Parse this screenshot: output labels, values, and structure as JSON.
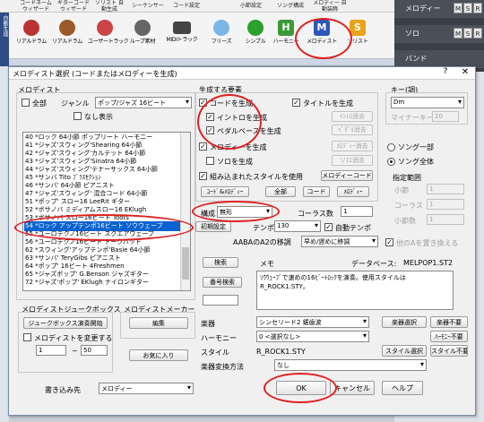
{
  "app": {
    "top_menu": [
      "コードネーム\nウィザード",
      "ギターコード\nウィザード",
      "ソリスト\n自動生成",
      "シーケンサー",
      "コード設定",
      "小節設定",
      "ソング構成",
      "メロディー\n自動装飾"
    ],
    "toolbar": [
      "リアルドラム",
      "リアルドラム",
      "ユーザートラック",
      "ループ素材",
      "MIDIトラック",
      "フリーズ",
      "シンプル",
      "ハーモニー",
      "メロディスト",
      "ソリスト"
    ],
    "left_strip": [
      "自動生成"
    ],
    "tracks": [
      {
        "name": "メロディー"
      },
      {
        "name": "ソロ"
      },
      {
        "name": "バンド"
      }
    ],
    "msr": [
      "M",
      "S",
      "R"
    ]
  },
  "dialog": {
    "title": "メロディスト選択 (コードまたはメロディーを生成)",
    "help": "?",
    "close": "✕",
    "left": {
      "section_label": "メロディスト",
      "all_label": "全部",
      "genre_label": "ジャンル",
      "genre_value": "ポップ/ジャズ 16ビート",
      "no_display_label": "なし表示",
      "items": [
        "40 *ロック 64小節 ポップリート ハーモニー",
        "41 *ジャズ'スウィング'Shearing 64小節",
        "42 *ジャズ'スウィング'カルテット 64小節",
        "43 *ジャズ'スウィング'Sinatra 64小節",
        "44 *ジャズ'スウィング'テナーサックス 64小節",
        "45 *サンバ Tito ﾌﾞﾗｽｾｸｼｮﾝ",
        "46 *サンバ' 64小節 ピアニスト",
        "47 *ジャズ'スウィング' 混合コード 64小節",
        "51 *ポップ' スロー16 LeeRit ギター",
        "52 *ボサノバ ミディアムスロー16 EKlugh",
        "53 *ボサノバ スロー16ビート Toots",
        "54 *ロック アップテンポ16ビート ソウウェーブ",
        "55 *ユーロテクノ16ビート スクエアウェーブ",
        "56 *ユーロテクノ16ビート トークバッド",
        "62 *スウィング'アップテンポ'Basie 64小節",
        "63 *サンバ' TeryGibs ピアニスト",
        "64 *ポップ' 16ビート 4Freshmen",
        "65 *ジャズポップ' G.Benson ジャズギター",
        "72 *ジャズ'ポップ' EKlugh ナイロンギター"
      ],
      "selected_index": 11,
      "jukebox_label": "メロディストジュークボックス",
      "jukebox_start": "ジュークボックス演奏開始",
      "random_label": "メロディストを変更する",
      "range_from": "1",
      "range_sep": "~",
      "range_to": "50",
      "maker_label": "メロディストメーカー",
      "edit": "編集",
      "favorite": "お気に入り",
      "write_to_label": "書き込み先",
      "write_to_value": "メロディー"
    },
    "gen": {
      "section_label": "生成する要素",
      "chords_label": "コードを生成",
      "title_label": "タイトルを生成",
      "intro_label": "イントロを生成",
      "intro_clear": "ｲﾝﾄﾛ消去",
      "pedal_label": "ペダルベースを生成",
      "pedal_clear": "ﾍﾟﾀﾞﾙ消去",
      "melody_label": "メロディーを生成",
      "melody_clear": "ﾒﾛﾃﾞｨｰ消去",
      "solo_label": "ソロを生成",
      "solo_clear": "ソロ消去",
      "embed_label": "組み込まれたスタイルを使用",
      "melody_code": "メロディーコード",
      "chord_melody": "ｺｰﾄﾞ&ﾒﾛﾃﾞｨｰ",
      "all": "全部",
      "chord": "コード",
      "melody": "ﾒﾛﾃﾞｨｰ"
    },
    "key": {
      "section_label": "キー(調)",
      "value": "Dm",
      "minor_key_label": "マイナーキー",
      "minor_key_value": "20"
    },
    "song": {
      "part_label": "ソング一部",
      "all_label": "ソング全体",
      "range_label": "指定範囲",
      "bar_label": "小節",
      "bar_value": "1",
      "chorus_label": "コーラス",
      "chorus_value": "1",
      "bars_label": "小節数",
      "bars_value": "1"
    },
    "form": {
      "structure_label": "構成",
      "structure_value": "無形",
      "chorus_count_label": "コーラス数",
      "chorus_count_value": "1",
      "init_settings": "初期設定",
      "tempo_label": "テンポ",
      "tempo_value": "130",
      "auto_tempo_label": "自動テンポ",
      "transition_label": "AABAのA2の移調",
      "transition_value": "早め/遅めに移調",
      "other_a_label": "他のAを置き換える"
    },
    "info": {
      "search": "検索",
      "memo_label": "メモ",
      "data_label": "データベース:",
      "data_value": "MELPOP1.ST2",
      "number_search": "番号検索",
      "memo_text": "ｿｳｳｪｰﾌﾞで速めの16ﾋﾞｰﾄﾛｯｸを演奏。使用スタイルはR_ROCK1.STY。"
    },
    "bottom": {
      "instrument_label": "楽器",
      "instrument_value": "シンセリード2 鋸歯波",
      "instrument_select": "楽器選択",
      "instrument_none": "楽器不要",
      "harmony_label": "ハーモニー",
      "harmony_value": "0 <選択なし>",
      "harmony_none": "ﾊｰﾓﾆｰ不要",
      "style_label": "スタイル",
      "style_value": "R_ROCK1.STY",
      "style_select": "スタイル選択",
      "style_none": "スタイル不要",
      "transform_label": "楽器変換方法",
      "transform_value": "なし",
      "ok": "OK",
      "cancel": "キャンセル",
      "help": "ヘルプ"
    }
  },
  "colors": {
    "selection": "#0a62d0",
    "annotation": "#e02020",
    "track_bg": "#3a3f47",
    "track_m": "#e6e6e6"
  }
}
